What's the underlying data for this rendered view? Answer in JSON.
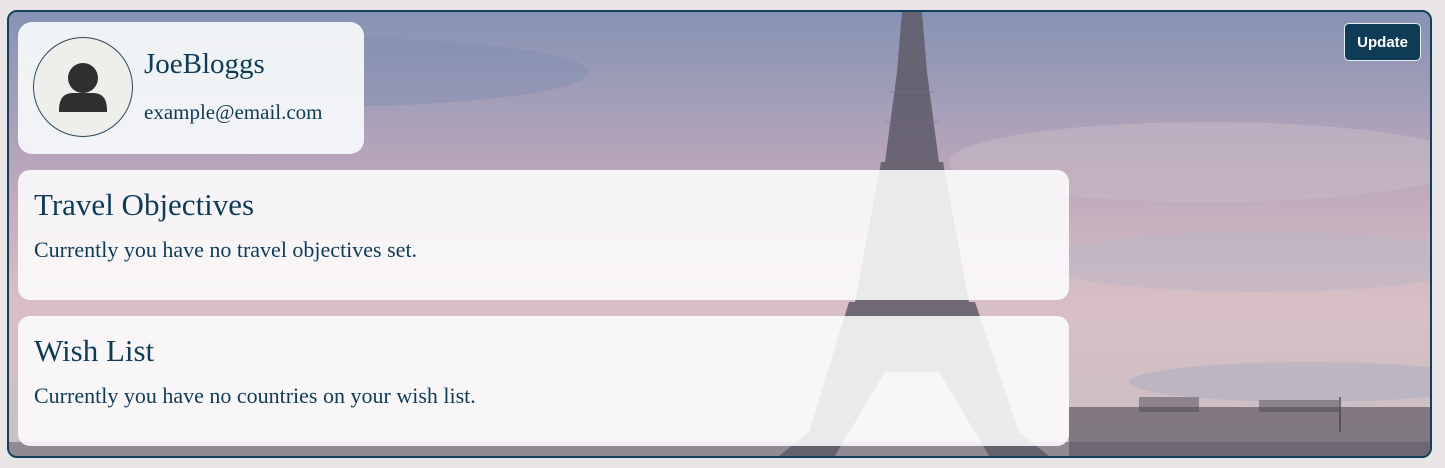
{
  "profile": {
    "username": "JoeBloggs",
    "email": "example@email.com",
    "avatar_icon": "user-silhouette-icon"
  },
  "toolbar": {
    "update_label": "Update"
  },
  "travel_objectives": {
    "title": "Travel Objectives",
    "message": "Currently you have no travel objectives set."
  },
  "wish_list": {
    "title": "Wish List",
    "message": "Currently you have no countries on your wish list."
  },
  "colors": {
    "accent": "#0f3b57",
    "frame_border": "#123f5b",
    "card_bg": "#f6f8fa"
  }
}
